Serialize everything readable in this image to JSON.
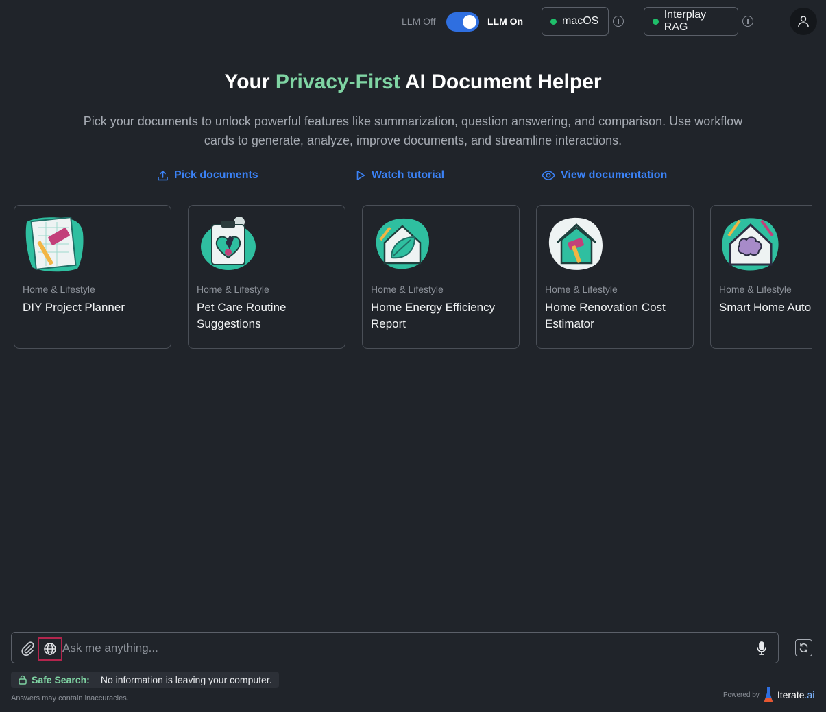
{
  "header": {
    "llm_off_label": "LLM Off",
    "llm_on_label": "LLM On",
    "llm_enabled": true,
    "os_label": "macOS",
    "rag_label": "Interplay RAG",
    "status_color": "#1fbf6a",
    "toggle_color": "#2f6fe0"
  },
  "hero": {
    "title_before": "Your ",
    "title_accent": "Privacy-First",
    "title_after": " AI Document Helper",
    "description": "Pick your documents to unlock powerful features like summarization, question answering, and comparison. Use workflow cards to generate, analyze, improve documents, and streamline interactions.",
    "accent_color": "#7fd4a3"
  },
  "actions": {
    "pick": "Pick documents",
    "tutorial": "Watch tutorial",
    "docs": "View documentation"
  },
  "cards": [
    {
      "category": "Home & Lifestyle",
      "title": "DIY Project Planner",
      "icon": "blueprint-hammer-icon"
    },
    {
      "category": "Home & Lifestyle",
      "title": "Pet Care Routine Suggestions",
      "icon": "pet-heart-clipboard-icon"
    },
    {
      "category": "Home & Lifestyle",
      "title": "Home Energy Efficiency Report",
      "icon": "eco-house-leaf-icon"
    },
    {
      "category": "Home & Lifestyle",
      "title": "Home Renovation Cost Estimator",
      "icon": "house-hammer-icon"
    },
    {
      "category": "Home & Lifestyle",
      "title": "Smart Home Automation Suggestions",
      "icon": "smart-house-brain-icon"
    }
  ],
  "composer": {
    "placeholder": "Ask me anything..."
  },
  "safe_search": {
    "label": "Safe Search:",
    "message": "No information is leaving your computer."
  },
  "footer": {
    "disclaimer": "Answers may contain inaccuracies.",
    "powered_by": "Powered by",
    "brand_name": "Iterate",
    "brand_suffix": ".ai"
  }
}
